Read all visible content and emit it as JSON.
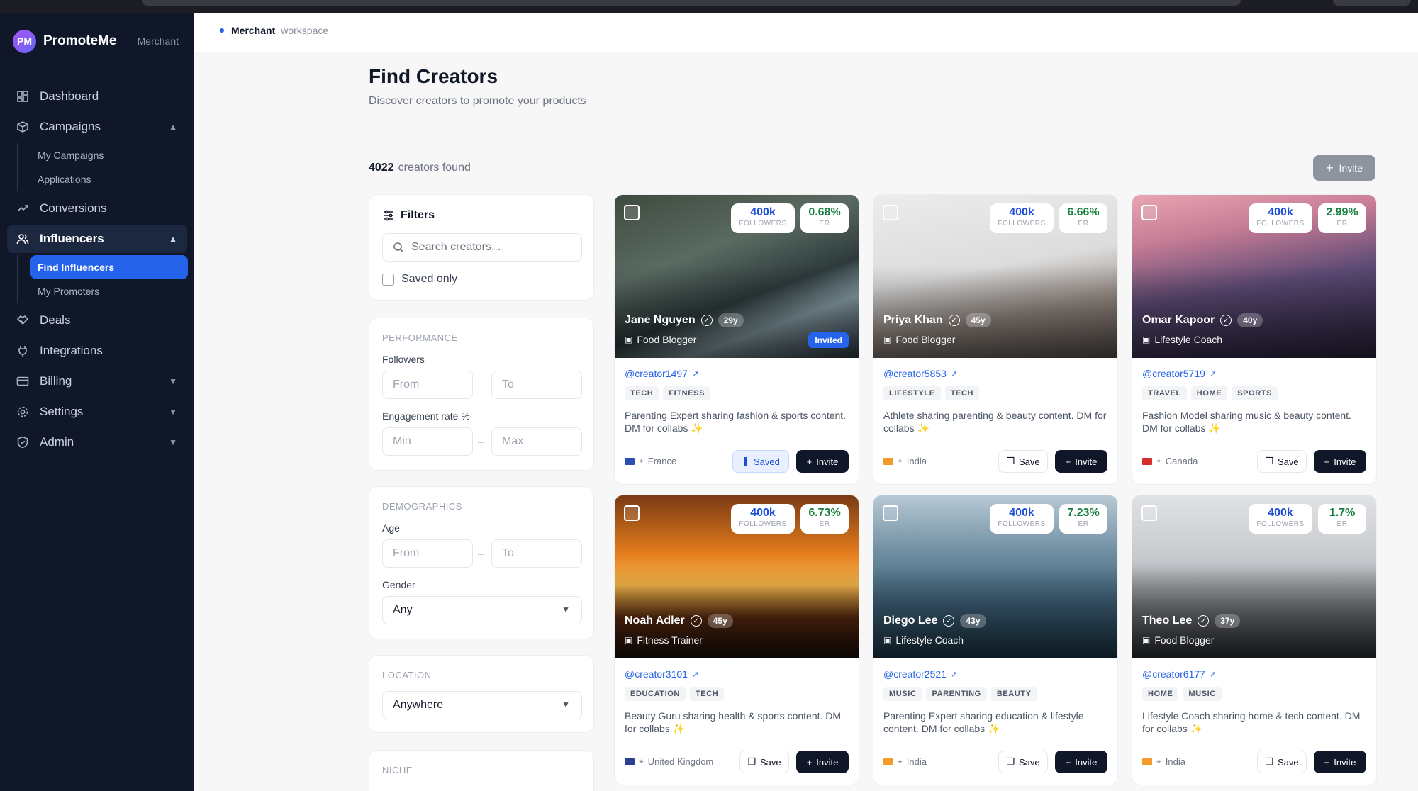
{
  "brand": {
    "logo": "PM",
    "name": "PromoteMe",
    "role": "Merchant"
  },
  "nav": {
    "dashboard": "Dashboard",
    "campaigns": "Campaigns",
    "campaigns_sub": [
      "My Campaigns",
      "Applications"
    ],
    "conversions": "Conversions",
    "influencers": "Influencers",
    "influencers_sub": [
      "Find Influencers",
      "My Promoters"
    ],
    "deals": "Deals",
    "integrations": "Integrations",
    "billing": "Billing",
    "settings": "Settings",
    "admin": "Admin"
  },
  "header": {
    "workspace_name": "Merchant",
    "workspace_label": "workspace"
  },
  "page": {
    "title": "Find Creators",
    "subtitle": "Discover creators to promote your products",
    "count": "4022",
    "count_label": "creators found",
    "invite_label": "Invite"
  },
  "filters": {
    "title": "Filters",
    "search_placeholder": "Search creators...",
    "saved_only": "Saved only",
    "performance": "PERFORMANCE",
    "followers": "Followers",
    "from": "From",
    "to": "To",
    "engagement": "Engagement rate %",
    "min": "Min",
    "max": "Max",
    "demographics": "DEMOGRAPHICS",
    "age": "Age",
    "gender": "Gender",
    "gender_value": "Any",
    "location": "LOCATION",
    "location_value": "Anywhere",
    "niche": "NICHE"
  },
  "labels": {
    "followers": "FOLLOWERS",
    "er": "ER",
    "save": "Save",
    "saved": "Saved",
    "invite": "Invite",
    "invited": "Invited"
  },
  "creators": [
    {
      "name": "Jane Nguyen",
      "age": "29y",
      "type": "Food Blogger",
      "followers": "400k",
      "er": "0.68%",
      "handle": "@creator1497",
      "tags": [
        "TECH",
        "FITNESS"
      ],
      "bio": "Parenting Expert sharing fashion & sports content. DM for collabs ✨",
      "country": "France",
      "flag": "#2b4fb5",
      "saved": true,
      "invited": true,
      "bg": "linear-gradient(160deg,#3e4a3f 0%,#5a6b62 35%,#2d3a3c 60%,#89a0a8 75%,#2e3b44 100%)"
    },
    {
      "name": "Priya Khan",
      "age": "45y",
      "type": "Food Blogger",
      "followers": "400k",
      "er": "6.66%",
      "handle": "@creator5853",
      "tags": [
        "LIFESTYLE",
        "TECH"
      ],
      "bio": "Athlete sharing parenting & beauty content. DM for collabs ✨",
      "country": "India",
      "flag": "#f39b2c",
      "saved": false,
      "invited": false,
      "bg": "linear-gradient(170deg,#ececec 0%,#dcdcdc 45%,#9a8f88 70%,#5e544f 100%)"
    },
    {
      "name": "Omar Kapoor",
      "age": "40y",
      "type": "Lifestyle Coach",
      "followers": "400k",
      "er": "2.99%",
      "handle": "@creator5719",
      "tags": [
        "TRAVEL",
        "HOME",
        "SPORTS"
      ],
      "bio": "Fashion Model sharing music & beauty content. DM for collabs ✨",
      "country": "Canada",
      "flag": "#d62d2d",
      "saved": false,
      "invited": false,
      "bg": "linear-gradient(170deg,#e8a5b2 0%,#c67c95 25%,#5c4a75 55%,#2b2440 100%)"
    },
    {
      "name": "Noah Adler",
      "age": "45y",
      "type": "Fitness Trainer",
      "followers": "400k",
      "er": "6.73%",
      "handle": "@creator3101",
      "tags": [
        "EDUCATION",
        "TECH"
      ],
      "bio": "Beauty Guru sharing health & sports content. DM for collabs ✨",
      "country": "United Kingdom",
      "flag": "#2a3f8f",
      "saved": false,
      "invited": false,
      "bg": "linear-gradient(180deg,#7a3a14 0%,#e27b1c 35%,#f6b84b 55%,#5a2a10 75%,#1c0f08 100%)"
    },
    {
      "name": "Diego Lee",
      "age": "43y",
      "type": "Lifestyle Coach",
      "followers": "400k",
      "er": "7.23%",
      "handle": "@creator2521",
      "tags": [
        "MUSIC",
        "PARENTING",
        "BEAUTY"
      ],
      "bio": "Parenting Expert sharing education & lifestyle content. DM for collabs ✨",
      "country": "India",
      "flag": "#f39b2c",
      "saved": false,
      "invited": false,
      "bg": "linear-gradient(180deg,#b7c9d4 0%,#6f8ea2 35%,#3e6178 65%,#1f3a4c 100%)"
    },
    {
      "name": "Theo Lee",
      "age": "37y",
      "type": "Food Blogger",
      "followers": "400k",
      "er": "1.7%",
      "handle": "@creator6177",
      "tags": [
        "HOME",
        "MUSIC"
      ],
      "bio": "Lifestyle Coach sharing home & tech content. DM for collabs ✨",
      "country": "India",
      "flag": "#f39b2c",
      "saved": false,
      "invited": false,
      "bg": "linear-gradient(180deg,#e0e2e5 0%,#c5c8cc 40%,#6f7378 70%,#2c2f33 100%)"
    }
  ]
}
